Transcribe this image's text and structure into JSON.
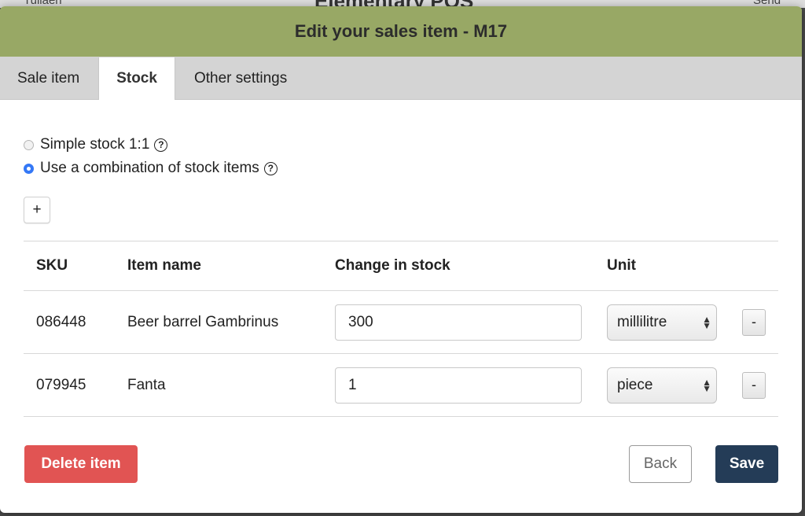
{
  "background": {
    "left_text": "Tuliaen",
    "center_text": "Elementary POS",
    "right_text": "Send"
  },
  "modal": {
    "title": "Edit your sales item - M17",
    "header_color": "#98a865"
  },
  "tabs": [
    {
      "label": "Sale item",
      "active": false
    },
    {
      "label": "Stock",
      "active": true
    },
    {
      "label": "Other settings",
      "active": false
    }
  ],
  "stock_mode": {
    "options": [
      {
        "label": "Simple stock 1:1",
        "checked": false,
        "help_icon": "question-circle-icon"
      },
      {
        "label": "Use a combination of stock items",
        "checked": true,
        "help_icon": "question-circle-icon"
      }
    ]
  },
  "add_button": {
    "label": "+"
  },
  "table": {
    "headers": [
      "SKU",
      "Item name",
      "Change in stock",
      "Unit"
    ],
    "rows": [
      {
        "sku": "086448",
        "name": "Beer barrel Gambrinus",
        "change": "300",
        "unit": "millilitre",
        "remove_label": "-"
      },
      {
        "sku": "079945",
        "name": "Fanta",
        "change": "1",
        "unit": "piece",
        "remove_label": "-"
      }
    ]
  },
  "footer": {
    "delete_label": "Delete item",
    "back_label": "Back",
    "save_label": "Save",
    "delete_color": "#e15453",
    "save_color": "#243c57"
  }
}
